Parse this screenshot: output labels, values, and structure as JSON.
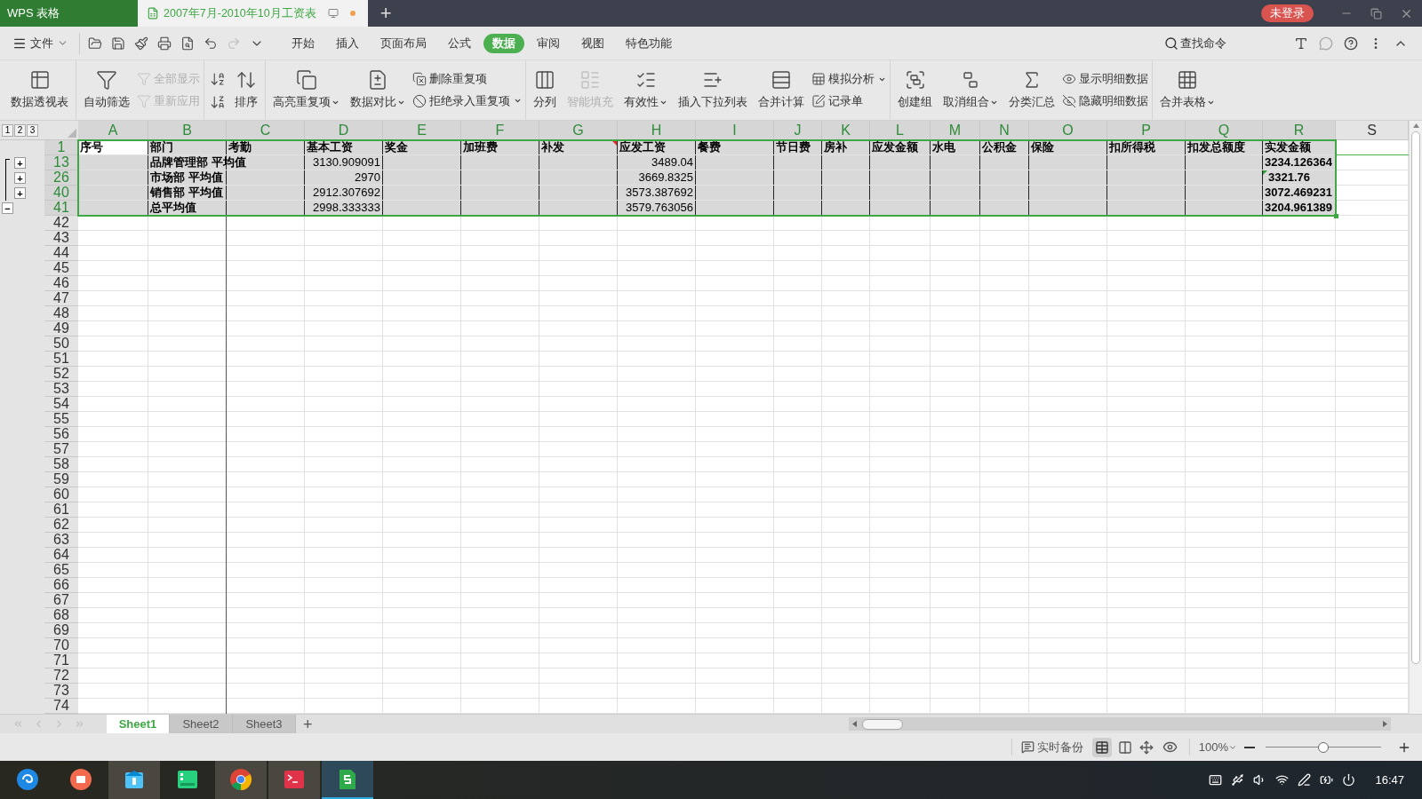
{
  "title_bar": {
    "app_tab": "WPS 表格",
    "document_tab": {
      "title": "2007年7月-2010年10月工资表",
      "modified": true
    },
    "new_tab": "+",
    "login": "未登录"
  },
  "menu": {
    "file": "文件",
    "tabs": [
      {
        "label": "开始",
        "selected": false
      },
      {
        "label": "插入",
        "selected": false
      },
      {
        "label": "页面布局",
        "selected": false
      },
      {
        "label": "公式",
        "selected": false
      },
      {
        "label": "数据",
        "selected": true
      },
      {
        "label": "审阅",
        "selected": false
      },
      {
        "label": "视图",
        "selected": false
      },
      {
        "label": "特色功能",
        "selected": false
      }
    ],
    "search": "查找命令"
  },
  "ribbon": {
    "groups": [
      {
        "columns": [
          {
            "kind": "large",
            "label": "数据透视表",
            "disabled": false,
            "dropdown": false
          }
        ]
      },
      {
        "columns": [
          {
            "kind": "large",
            "label": "自动筛选",
            "disabled": false,
            "dropdown": false
          },
          {
            "kind": "stack",
            "items": [
              {
                "label": "全部显示",
                "disabled": true,
                "dropdown": false
              },
              {
                "label": "重新应用",
                "disabled": true,
                "dropdown": false
              }
            ]
          }
        ]
      },
      {
        "columns": [
          {
            "kind": "iconstack",
            "items": [
              {
                "disabled": false
              },
              {
                "disabled": false
              }
            ]
          },
          {
            "kind": "large",
            "label": "排序",
            "disabled": false,
            "dropdown": false
          }
        ]
      },
      {
        "columns": [
          {
            "kind": "large",
            "label": "高亮重复项",
            "disabled": false,
            "dropdown": true
          },
          {
            "kind": "large",
            "label": "数据对比",
            "disabled": false,
            "dropdown": true
          },
          {
            "kind": "stack",
            "items": [
              {
                "label": "删除重复项",
                "disabled": false,
                "dropdown": false
              },
              {
                "label": "拒绝录入重复项",
                "disabled": false,
                "dropdown": true
              }
            ]
          }
        ]
      },
      {
        "columns": [
          {
            "kind": "large",
            "label": "分列",
            "disabled": false,
            "dropdown": false
          },
          {
            "kind": "large",
            "label": "智能填充",
            "disabled": true,
            "dropdown": false
          },
          {
            "kind": "large",
            "label": "有效性",
            "disabled": false,
            "dropdown": true
          },
          {
            "kind": "large",
            "label": "插入下拉列表",
            "disabled": false,
            "dropdown": false
          },
          {
            "kind": "large",
            "label": "合并计算",
            "disabled": false,
            "dropdown": false
          },
          {
            "kind": "stack",
            "items": [
              {
                "label": "模拟分析",
                "disabled": false,
                "dropdown": true
              },
              {
                "label": "记录单",
                "disabled": false,
                "dropdown": false
              }
            ]
          }
        ]
      },
      {
        "columns": [
          {
            "kind": "large",
            "label": "创建组",
            "disabled": false,
            "dropdown": false
          },
          {
            "kind": "large",
            "label": "取消组合",
            "disabled": false,
            "dropdown": true
          },
          {
            "kind": "large",
            "label": "分类汇总",
            "disabled": false,
            "dropdown": false
          },
          {
            "kind": "stack",
            "items": [
              {
                "label": "显示明细数据",
                "disabled": false,
                "dropdown": false
              },
              {
                "label": "隐藏明细数据",
                "disabled": false,
                "dropdown": false
              }
            ]
          }
        ]
      },
      {
        "columns": [
          {
            "kind": "large",
            "label": "合并表格",
            "disabled": false,
            "dropdown": true
          }
        ]
      }
    ]
  },
  "sheet": {
    "outline_levels": [
      "1",
      "2",
      "3"
    ],
    "columns": [
      {
        "letter": "A",
        "selected": true
      },
      {
        "letter": "B",
        "selected": true
      },
      {
        "letter": "C",
        "selected": true
      },
      {
        "letter": "D",
        "selected": true
      },
      {
        "letter": "E",
        "selected": true
      },
      {
        "letter": "F",
        "selected": true
      },
      {
        "letter": "G",
        "selected": true
      },
      {
        "letter": "H",
        "selected": true
      },
      {
        "letter": "I",
        "selected": true
      },
      {
        "letter": "J",
        "selected": true
      },
      {
        "letter": "K",
        "selected": true
      },
      {
        "letter": "L",
        "selected": true
      },
      {
        "letter": "M",
        "selected": true
      },
      {
        "letter": "N",
        "selected": true
      },
      {
        "letter": "O",
        "selected": true
      },
      {
        "letter": "P",
        "selected": true
      },
      {
        "letter": "Q",
        "selected": true
      },
      {
        "letter": "R",
        "selected": true
      },
      {
        "letter": "S",
        "selected": false
      }
    ],
    "rows": [
      {
        "number": "1",
        "selected": true,
        "cells": [
          {
            "text": "序号",
            "bold": true,
            "kind": "text",
            "active": true,
            "comment": false,
            "error_flag": false
          },
          {
            "text": "部门",
            "bold": true,
            "kind": "text",
            "active": false,
            "comment": false,
            "error_flag": false
          },
          {
            "text": "考勤",
            "bold": true,
            "kind": "text",
            "active": false,
            "comment": false,
            "error_flag": false
          },
          {
            "text": "基本工资",
            "bold": true,
            "kind": "text",
            "active": false,
            "comment": false,
            "error_flag": false
          },
          {
            "text": "奖金",
            "bold": true,
            "kind": "text",
            "active": false,
            "comment": false,
            "error_flag": false
          },
          {
            "text": "加班费",
            "bold": true,
            "kind": "text",
            "active": false,
            "comment": false,
            "error_flag": false
          },
          {
            "text": "补发",
            "bold": true,
            "kind": "text",
            "active": false,
            "comment": true,
            "error_flag": false
          },
          {
            "text": "应发工资",
            "bold": true,
            "kind": "text",
            "active": false,
            "comment": false,
            "error_flag": false
          },
          {
            "text": "餐费",
            "bold": true,
            "kind": "text",
            "active": false,
            "comment": false,
            "error_flag": false
          },
          {
            "text": "节日费",
            "bold": true,
            "kind": "text",
            "active": false,
            "comment": false,
            "error_flag": false
          },
          {
            "text": "房补",
            "bold": true,
            "kind": "text",
            "active": false,
            "comment": false,
            "error_flag": false
          },
          {
            "text": "应发金额",
            "bold": true,
            "kind": "text",
            "active": false,
            "comment": false,
            "error_flag": false
          },
          {
            "text": "水电",
            "bold": true,
            "kind": "text",
            "active": false,
            "comment": false,
            "error_flag": false
          },
          {
            "text": "公积金",
            "bold": true,
            "kind": "text",
            "active": false,
            "comment": false,
            "error_flag": false
          },
          {
            "text": "保险",
            "bold": true,
            "kind": "text",
            "active": false,
            "comment": false,
            "error_flag": false
          },
          {
            "text": "扣所得税",
            "bold": true,
            "kind": "text",
            "active": false,
            "comment": false,
            "error_flag": false
          },
          {
            "text": "扣发总额度",
            "bold": true,
            "kind": "text",
            "active": false,
            "comment": false,
            "error_flag": false
          },
          {
            "text": "实发金额",
            "bold": true,
            "kind": "text",
            "active": false,
            "comment": false,
            "error_flag": false
          }
        ]
      },
      {
        "number": "13",
        "selected": true,
        "outline": "+",
        "cells": [
          null,
          {
            "text": "品牌管理部 平均值",
            "bold": true,
            "kind": "text",
            "active": false,
            "comment": false,
            "error_flag": false
          },
          null,
          {
            "text": "3130.909091",
            "bold": false,
            "kind": "number",
            "active": false,
            "comment": false,
            "error_flag": false
          },
          null,
          null,
          null,
          {
            "text": "3489.04",
            "bold": false,
            "kind": "number",
            "active": false,
            "comment": false,
            "error_flag": false
          },
          null,
          null,
          null,
          null,
          null,
          null,
          null,
          null,
          null,
          {
            "text": "3234.126364",
            "bold": true,
            "kind": "text",
            "active": false,
            "comment": false,
            "error_flag": false
          }
        ]
      },
      {
        "number": "26",
        "selected": true,
        "outline": "+",
        "cells": [
          null,
          {
            "text": "市场部 平均值",
            "bold": true,
            "kind": "text",
            "active": false,
            "comment": false,
            "error_flag": false
          },
          null,
          {
            "text": "2970",
            "bold": false,
            "kind": "number",
            "active": false,
            "comment": false,
            "error_flag": false
          },
          null,
          null,
          null,
          {
            "text": "3669.8325",
            "bold": false,
            "kind": "number",
            "active": false,
            "comment": false,
            "error_flag": false
          },
          null,
          null,
          null,
          null,
          null,
          null,
          null,
          null,
          null,
          {
            "text": "3321.76",
            "bold": true,
            "kind": "text",
            "active": false,
            "comment": false,
            "error_flag": true
          }
        ]
      },
      {
        "number": "40",
        "selected": true,
        "outline": "+",
        "cells": [
          null,
          {
            "text": "销售部 平均值",
            "bold": true,
            "kind": "text",
            "active": false,
            "comment": false,
            "error_flag": false
          },
          null,
          {
            "text": "2912.307692",
            "bold": false,
            "kind": "number",
            "active": false,
            "comment": false,
            "error_flag": false
          },
          null,
          null,
          null,
          {
            "text": "3573.387692",
            "bold": false,
            "kind": "number",
            "active": false,
            "comment": false,
            "error_flag": false
          },
          null,
          null,
          null,
          null,
          null,
          null,
          null,
          null,
          null,
          {
            "text": "3072.469231",
            "bold": true,
            "kind": "text",
            "active": false,
            "comment": false,
            "error_flag": false
          }
        ]
      },
      {
        "number": "41",
        "selected": true,
        "outline": "−",
        "cells": [
          null,
          {
            "text": "总平均值",
            "bold": true,
            "kind": "text",
            "active": false,
            "comment": false,
            "error_flag": false
          },
          null,
          {
            "text": "2998.333333",
            "bold": false,
            "kind": "number",
            "active": false,
            "comment": false,
            "error_flag": false
          },
          null,
          null,
          null,
          {
            "text": "3579.763056",
            "bold": false,
            "kind": "number",
            "active": false,
            "comment": false,
            "error_flag": false
          },
          null,
          null,
          null,
          null,
          null,
          null,
          null,
          null,
          null,
          {
            "text": "3204.961389",
            "bold": true,
            "kind": "text",
            "active": false,
            "comment": false,
            "error_flag": false
          }
        ]
      },
      {
        "number": "42",
        "selected": false
      },
      {
        "number": "43",
        "selected": false
      },
      {
        "number": "44",
        "selected": false
      },
      {
        "number": "45",
        "selected": false
      },
      {
        "number": "46",
        "selected": false
      },
      {
        "number": "47",
        "selected": false
      },
      {
        "number": "48",
        "selected": false
      },
      {
        "number": "49",
        "selected": false
      },
      {
        "number": "50",
        "selected": false
      },
      {
        "number": "51",
        "selected": false
      },
      {
        "number": "52",
        "selected": false
      },
      {
        "number": "53",
        "selected": false
      },
      {
        "number": "54",
        "selected": false
      },
      {
        "number": "55",
        "selected": false
      },
      {
        "number": "56",
        "selected": false
      },
      {
        "number": "57",
        "selected": false
      },
      {
        "number": "58",
        "selected": false
      },
      {
        "number": "59",
        "selected": false
      },
      {
        "number": "60",
        "selected": false
      },
      {
        "number": "61",
        "selected": false
      },
      {
        "number": "62",
        "selected": false
      },
      {
        "number": "63",
        "selected": false
      },
      {
        "number": "64",
        "selected": false
      },
      {
        "number": "65",
        "selected": false
      },
      {
        "number": "66",
        "selected": false
      },
      {
        "number": "67",
        "selected": false
      },
      {
        "number": "68",
        "selected": false
      },
      {
        "number": "69",
        "selected": false
      },
      {
        "number": "70",
        "selected": false
      },
      {
        "number": "71",
        "selected": false
      },
      {
        "number": "72",
        "selected": false
      },
      {
        "number": "73",
        "selected": false
      },
      {
        "number": "74",
        "selected": false
      }
    ]
  },
  "sheet_tabs": [
    {
      "label": "Sheet1",
      "selected": true
    },
    {
      "label": "Sheet2",
      "selected": false
    },
    {
      "label": "Sheet3",
      "selected": false
    }
  ],
  "add_sheet": "+",
  "status_bar": {
    "backup": "实时备份",
    "zoom": "100%",
    "zoom_slider": {
      "level": 0.5
    }
  },
  "taskbar": {
    "apps": [
      {
        "selected": false,
        "running": false
      },
      {
        "selected": false,
        "running": false
      },
      {
        "selected": false,
        "running": true
      },
      {
        "selected": false,
        "running": false
      },
      {
        "selected": false,
        "running": true
      },
      {
        "selected": false,
        "running": true
      },
      {
        "selected": true,
        "running": true
      }
    ],
    "clock": "16:47"
  }
}
